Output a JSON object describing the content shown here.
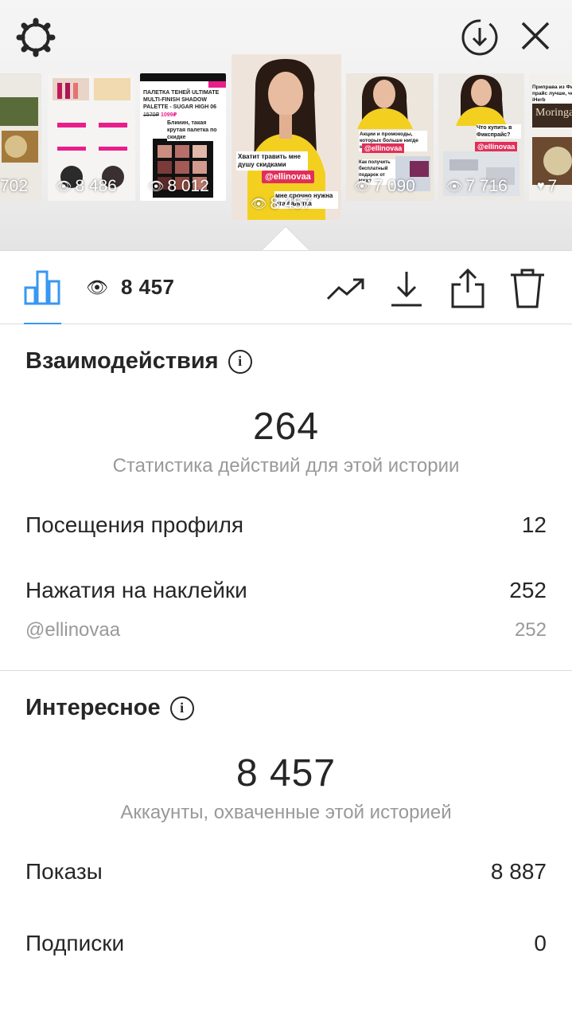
{
  "header": {
    "settings_icon": "gear-icon",
    "download_icon": "circle-download-icon",
    "close_icon": "close-icon"
  },
  "stories": [
    {
      "views": "702",
      "theme": "food"
    },
    {
      "views": "8 486",
      "theme": "makeup-products"
    },
    {
      "views": "8 012",
      "theme": "nyx-palette"
    },
    {
      "views": "8 457",
      "theme": "selfie-video",
      "active": true
    },
    {
      "views": "7 090",
      "theme": "promo-selfie"
    },
    {
      "views": "7 716",
      "theme": "fixprice-selfie"
    },
    {
      "views": "7",
      "theme": "grocery"
    }
  ],
  "story_texts": {
    "nyx_header": "ПАЛЕТКА ТЕНЕЙ ULTIMATE MULTI-FINISH SHADOW PALETTE - SUGAR HIGH 06",
    "nyx_price_old": "1570₽",
    "nyx_price_new": "1099₽",
    "nyx_caption": "Блииин, такая крутая палетка по скидке",
    "active_caption": "Хватит травить мне душу скидками",
    "active_mention": "@ellinovaa",
    "active_footer": "мне срочно нужна эта палетка",
    "promo_caption": "Акции и промокоды, которых больше нигде нет!",
    "promo_mention": "@ellinovaa",
    "promo_q": "Как получить бесплатный подарок от NYX?",
    "fix_caption": "Что купить в Фикспрайс?",
    "fix_mention": "@ellinovaa",
    "grocery_caption": "Приправа из Фикс прайс лучше, чем с iHerb",
    "grocery_label": "Moringa"
  },
  "toolbar": {
    "insights_icon": "bar-chart-icon",
    "eye_icon": "eye-icon",
    "views": "8 457",
    "trend_icon": "trending-up-icon",
    "save_icon": "download-icon",
    "share_icon": "share-icon",
    "delete_icon": "trash-icon"
  },
  "interactions": {
    "title": "Взаимодействия",
    "total": "264",
    "caption": "Статистика действий для этой истории",
    "rows": [
      {
        "label": "Посещения профиля",
        "value": "12"
      },
      {
        "label": "Нажатия на наклейки",
        "value": "252"
      }
    ],
    "sub_row": {
      "label": "@ellinovaa",
      "value": "252"
    }
  },
  "discovery": {
    "title": "Интересное",
    "total": "8 457",
    "caption": "Аккаунты, охваченные этой историей",
    "rows": [
      {
        "label": "Показы",
        "value": "8 887"
      },
      {
        "label": "Подписки",
        "value": "0"
      }
    ]
  },
  "colors": {
    "accent": "#3897f0",
    "mention": "#e0305a",
    "muted": "#999999",
    "divider": "#dbdbdb"
  }
}
